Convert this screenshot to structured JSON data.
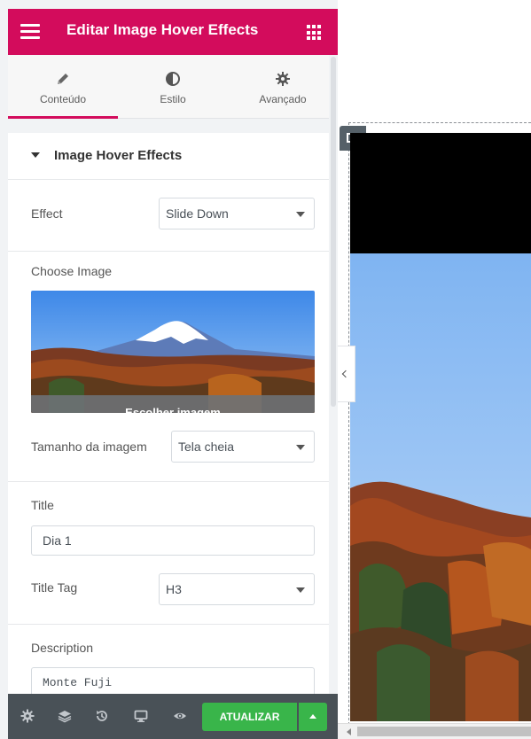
{
  "header": {
    "title": "Editar Image Hover Effects",
    "bg_color": "#d30c5c",
    "menu_icon": "hamburger-icon",
    "grid_icon": "apps-grid-icon"
  },
  "tabs": [
    {
      "label": "Conteúdo",
      "icon": "pencil-icon",
      "active": true
    },
    {
      "label": "Estilo",
      "icon": "contrast-icon",
      "active": false
    },
    {
      "label": "Avançado",
      "icon": "gear-icon",
      "active": false
    }
  ],
  "section": {
    "title": "Image Hover Effects"
  },
  "controls": {
    "effect": {
      "label": "Effect",
      "value": "Slide Down"
    },
    "choose_image": {
      "label": "Choose Image",
      "overlay_text": "Escolher imagem"
    },
    "image_size": {
      "label": "Tamanho da imagem",
      "value": "Tela cheia"
    },
    "title": {
      "label": "Title",
      "value": "Dia 1"
    },
    "title_tag": {
      "label": "Title Tag",
      "value": "H3"
    },
    "description": {
      "label": "Description",
      "value": "Monte Fuji"
    }
  },
  "bottom_bar": {
    "icons": [
      "gear-icon",
      "layers-icon",
      "history-icon",
      "responsive-icon",
      "eye-icon"
    ],
    "update_label": "ATUALIZAR",
    "update_color": "#39b54a"
  }
}
